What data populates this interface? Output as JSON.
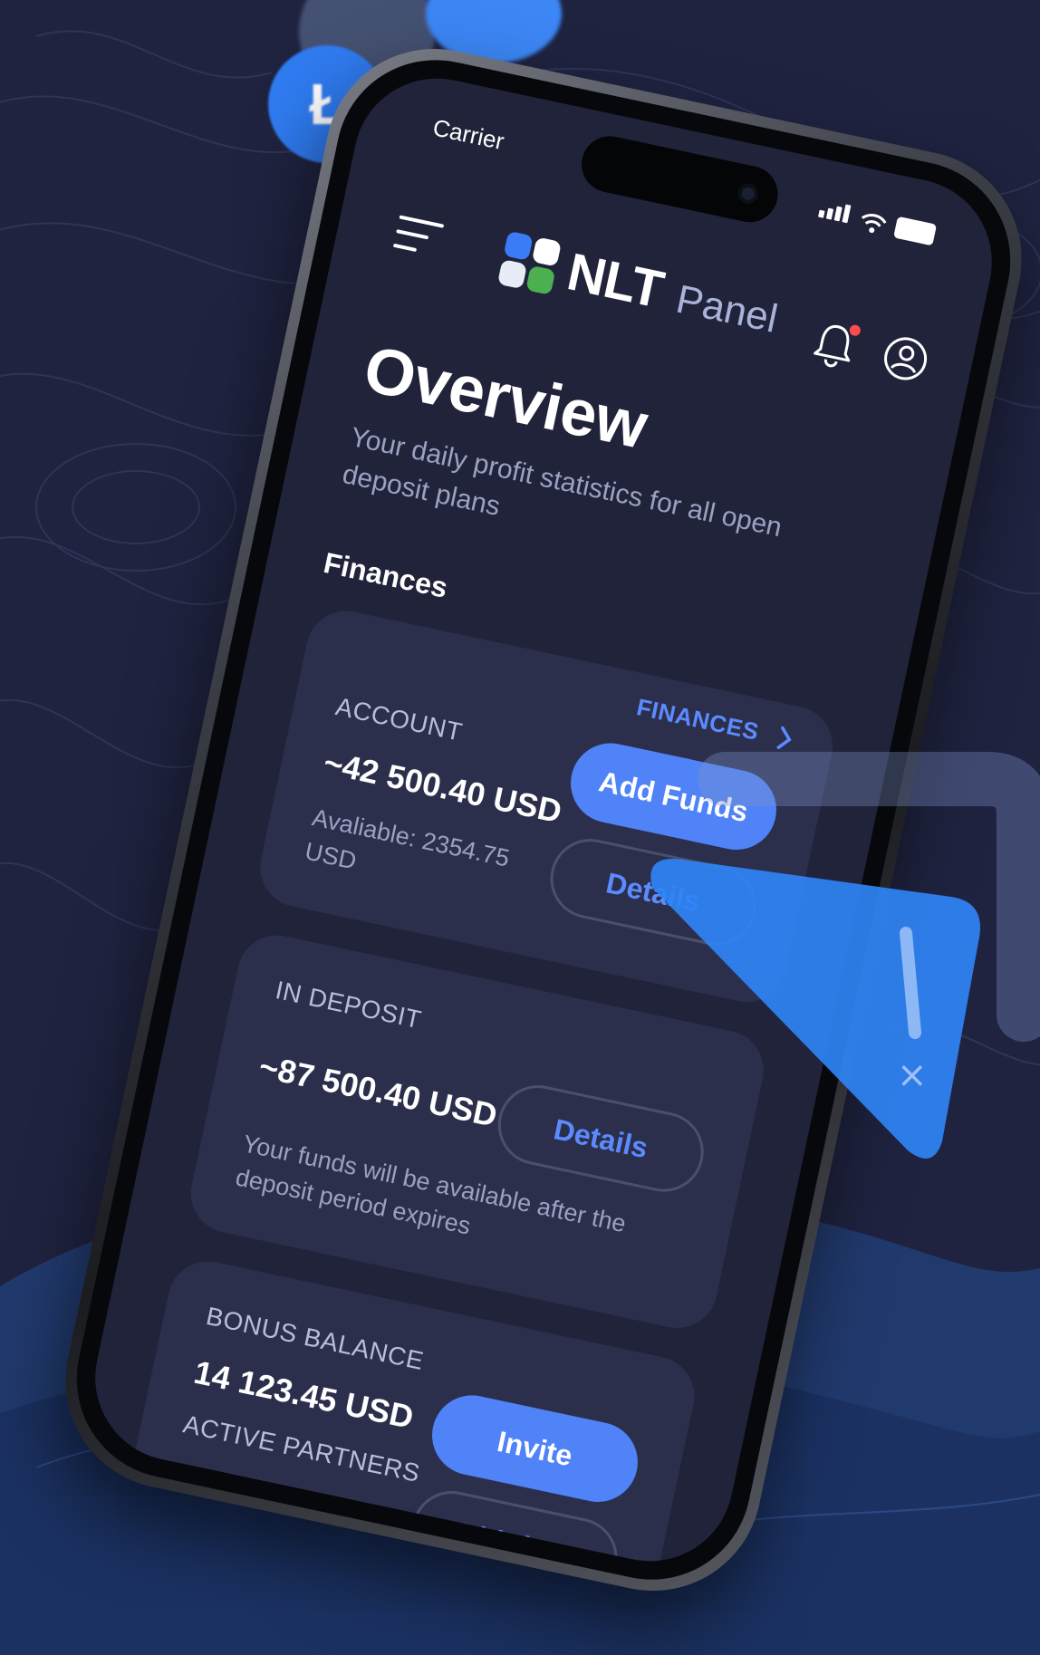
{
  "status_bar": {
    "carrier": "Carrier"
  },
  "app": {
    "logo_primary": "NLT",
    "logo_secondary": "Panel"
  },
  "page": {
    "title": "Overview",
    "subtitle": "Your daily profit statistics for all open deposit plans"
  },
  "finances": {
    "section_title": "Finances",
    "link_label": "FINANCES",
    "account": {
      "label": "ACCOUNT",
      "value": "~42 500.40 USD",
      "available": "Avaliable: 2354.75 USD",
      "primary_button": "Add Funds",
      "secondary_button": "Details"
    },
    "deposit": {
      "label": "IN DEPOSIT",
      "value": "~87 500.40 USD",
      "note": "Your funds will be available after the deposit period expires",
      "button": "Details"
    },
    "bonus": {
      "label": "BONUS BALANCE",
      "value": "14 123.45 USD",
      "partners_label": "ACTIVE PARTNERS",
      "primary_button": "Invite",
      "secondary_button": "Withdraw"
    }
  },
  "colors": {
    "background": "#1f2340",
    "screen": "#21233a",
    "card": "#2c2f4c",
    "accent": "#4f83f7",
    "link": "#5b8bff",
    "notification_dot": "#ff4b4b"
  },
  "icons": [
    "litecoin-coin-icon",
    "menu-icon",
    "bell-icon",
    "profile-icon",
    "chevron-right-icon",
    "signal-icon",
    "wifi-icon",
    "battery-icon"
  ]
}
